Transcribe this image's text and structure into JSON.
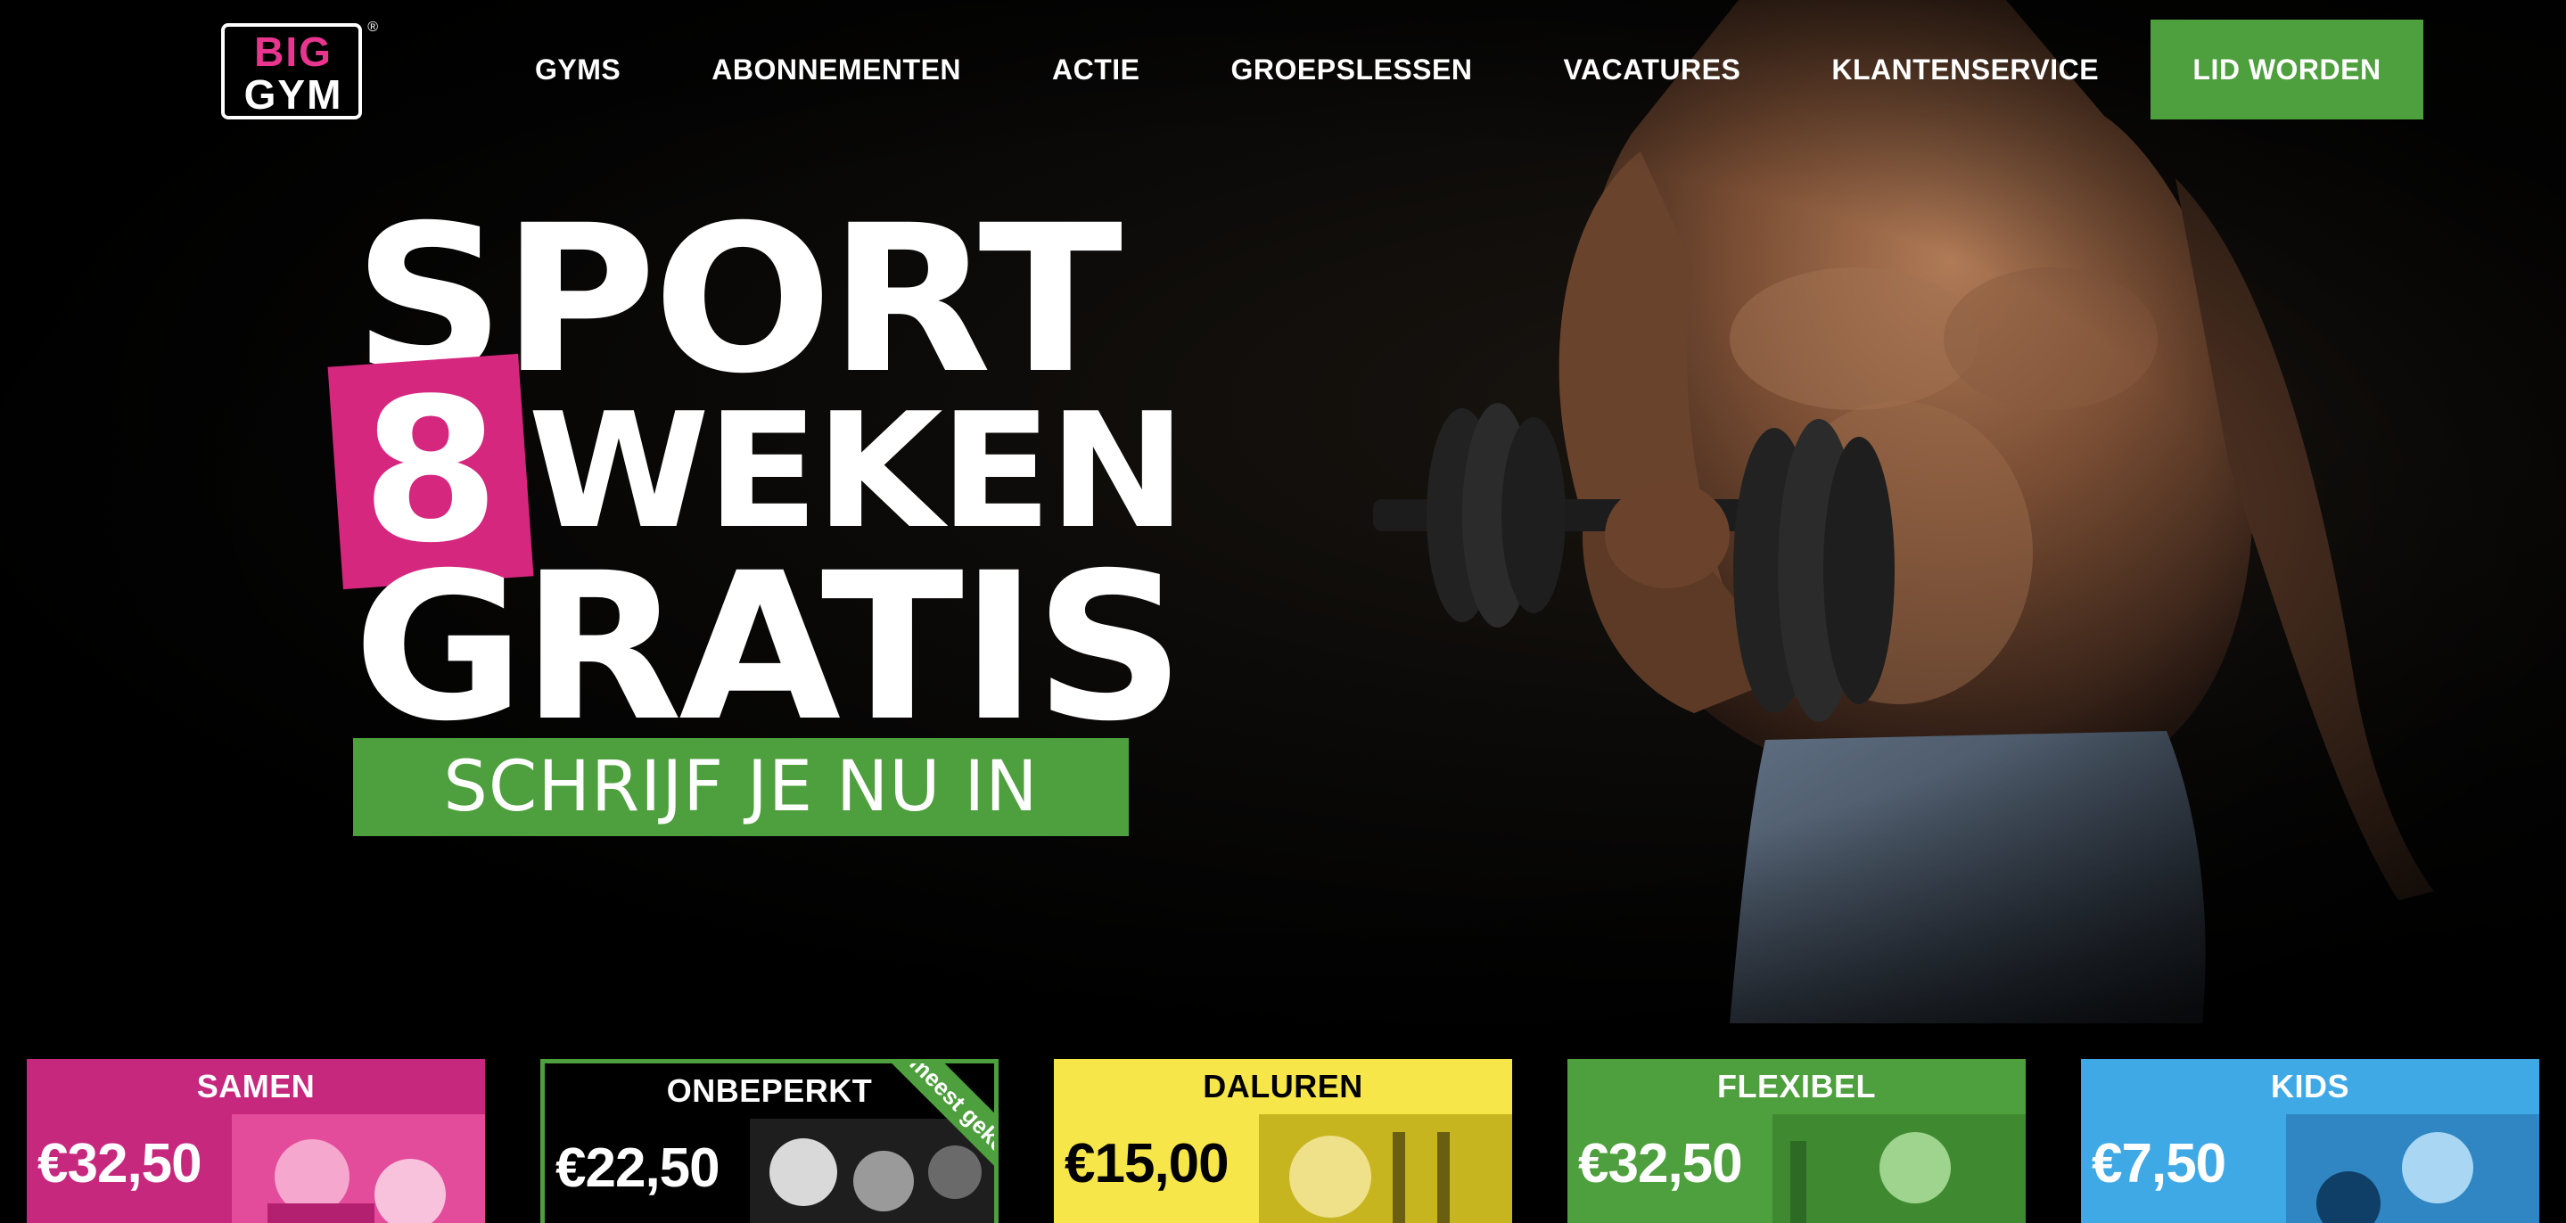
{
  "brand": {
    "logo_top": "BIG",
    "logo_bottom": "GYM",
    "registered": "®"
  },
  "nav": {
    "items": [
      "GYMS",
      "ABONNEMENTEN",
      "ACTIE",
      "GROEPSLESSEN",
      "VACATURES",
      "KLANTENSERVICE"
    ],
    "cta_label": "LID WORDEN"
  },
  "hero": {
    "line1": "SPORT",
    "badge_number": "8",
    "line2": "WEKEN",
    "line3": "GRATIS",
    "button_label": "SCHRIJF JE NU IN"
  },
  "plans": [
    {
      "name": "SAMEN",
      "price": "€32,50"
    },
    {
      "name": "ONBEPERKT",
      "price": "€22,50",
      "ribbon": "meest gekozen"
    },
    {
      "name": "DALUREN",
      "price": "€15,00"
    },
    {
      "name": "FLEXIBEL",
      "price": "€32,50"
    },
    {
      "name": "KIDS",
      "price": "€7,50"
    }
  ],
  "colors": {
    "brand_pink": "#d6277f",
    "brand_green": "#4e9f3d",
    "daluren_yellow": "#f7e64a",
    "kids_blue": "#3fa9e6"
  }
}
